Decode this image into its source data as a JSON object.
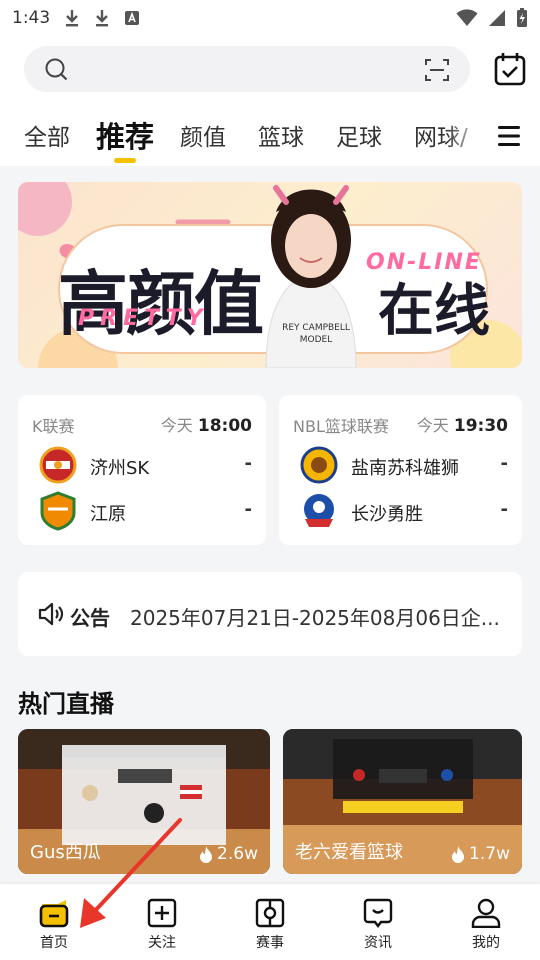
{
  "status_bar": {
    "time": "1:43"
  },
  "search": {
    "placeholder": ""
  },
  "tabs": [
    {
      "label": "全部"
    },
    {
      "label": "推荐"
    },
    {
      "label": "颜值"
    },
    {
      "label": "篮球"
    },
    {
      "label": "足球"
    },
    {
      "label": "网球/"
    }
  ],
  "banner": {
    "title": "高颜值",
    "title2": "在线",
    "sub": "PRETTY",
    "online": "ON-LINE",
    "shirt_text": "REY CAMPBELL MODEL"
  },
  "matches": [
    {
      "league": "K联赛",
      "day": "今天",
      "time": "18:00",
      "teams": [
        {
          "name": "济州SK",
          "score": "-"
        },
        {
          "name": "江原",
          "score": "-"
        }
      ]
    },
    {
      "league": "NBL篮球联赛",
      "day": "今天",
      "time": "19:30",
      "teams": [
        {
          "name": "盐南苏科雄狮",
          "score": "-"
        },
        {
          "name": "长沙勇胜",
          "score": "-"
        }
      ]
    }
  ],
  "notice": {
    "label": "公告",
    "text": "2025年07月21日-2025年08月06日企..."
  },
  "section_title": "热门直播",
  "streams": [
    {
      "name": "Gus西瓜",
      "views": "2.6w"
    },
    {
      "name": "老六爱看篮球",
      "views": "1.7w"
    }
  ],
  "bottom_nav": [
    {
      "label": "首页"
    },
    {
      "label": "关注"
    },
    {
      "label": "赛事"
    },
    {
      "label": "资讯"
    },
    {
      "label": "我的"
    }
  ],
  "colors": {
    "accent": "#f5c000",
    "arrow": "#e8362b",
    "text": "#222222"
  }
}
